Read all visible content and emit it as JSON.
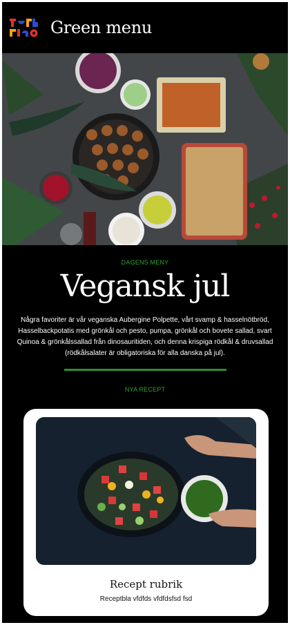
{
  "header": {
    "title": "Green menu",
    "logo_icon": "techrico-logo-icon"
  },
  "hero": {
    "icon": "vegan-christmas-dinner-table-photo"
  },
  "intro": {
    "kicker": "DAGENS MENY",
    "headline": "Vegansk jul",
    "body": "Några favoriter är vår veganska Aubergine Polpette, vårt svamp & hasselnötbröd, Hasselbackpotatis med grönkål och pesto, pumpa, grönkål och bovete sallad, svart Quinoa & grönkålssallad från dinosauritiden, och denna krispiga rödkål & druvsallad (rödkålsalater är obligatoriska för alla danska på jul).",
    "section_label": "NYA RECEPT"
  },
  "recipe_card": {
    "image_icon": "salad-bowl-photo",
    "title": "Recept rubrik",
    "description": "Receptbla vfdfds vfdfdsfsd fsd"
  },
  "colors": {
    "background": "#000000",
    "accent_green": "#2fa52f",
    "card": "#ffffff"
  }
}
